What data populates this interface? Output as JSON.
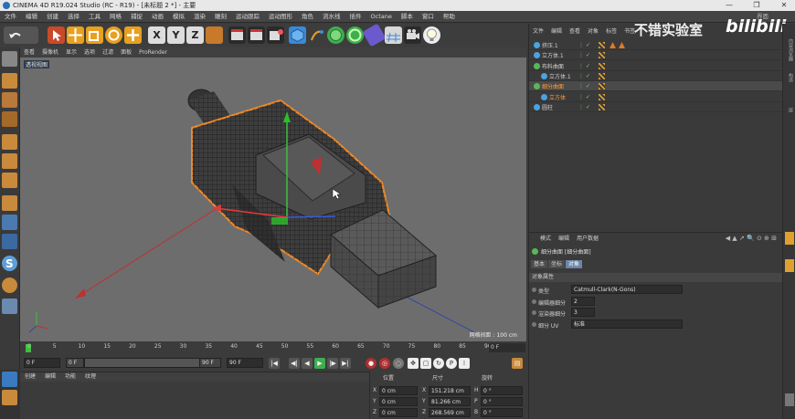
{
  "window": {
    "title": "CINEMA 4D R19.024 Studio (RC - R19) - [未标题 2 *] - 主要",
    "controls": [
      "—",
      "❐",
      "✕"
    ]
  },
  "menubar": {
    "items": [
      "文件",
      "编辑",
      "创建",
      "选择",
      "工具",
      "网格",
      "捕捉",
      "动画",
      "模拟",
      "渲染",
      "雕刻",
      "运动跟踪",
      "运动图形",
      "角色",
      "流水线",
      "插件",
      "Octane",
      "脚本",
      "窗口",
      "帮助"
    ],
    "right_label": "界面"
  },
  "viewport": {
    "menu": [
      "查看",
      "摄像机",
      "显示",
      "选项",
      "过滤",
      "面板",
      "ProRender"
    ],
    "label": "透视视图",
    "grid_label": "网格间距 : 100 cm"
  },
  "timeline": {
    "ticks": [
      "0",
      "5",
      "10",
      "15",
      "20",
      "25",
      "30",
      "35",
      "40",
      "45",
      "50",
      "55",
      "60",
      "65",
      "70",
      "75",
      "80",
      "85",
      "90"
    ],
    "end_frame": "0 F"
  },
  "transport": {
    "current": "0 F",
    "preview_start": "0 F",
    "preview_end": "90 F",
    "end": "90 F"
  },
  "material_manager": {
    "menu": [
      "创建",
      "编辑",
      "功能",
      "纹理"
    ]
  },
  "coords": {
    "headers": {
      "position": "位置",
      "size": "尺寸",
      "rotation": "旋转"
    },
    "rows": [
      {
        "axis": "X",
        "pos": "0 cm",
        "size_axis": "X",
        "size": "151.218 cm",
        "rot_axis": "H",
        "rot": "0 °"
      },
      {
        "axis": "Y",
        "pos": "0 cm",
        "size_axis": "Y",
        "size": "81.266 cm",
        "rot_axis": "P",
        "rot": "0 °"
      },
      {
        "axis": "Z",
        "pos": "0 cm",
        "size_axis": "Z",
        "size": "268.569 cm",
        "rot_axis": "B",
        "rot": "0 °"
      }
    ]
  },
  "object_manager": {
    "menu": [
      "文件",
      "编辑",
      "查看",
      "对象",
      "标签",
      "书签"
    ],
    "objects": [
      {
        "name": "挤压.1",
        "indent": 0,
        "icon_color": "#4aa3e0",
        "highlight": false,
        "selected": false
      },
      {
        "name": "立方体.1",
        "indent": 0,
        "icon_color": "#4aa3e0",
        "highlight": false,
        "selected": false
      },
      {
        "name": "布料曲面",
        "indent": 0,
        "icon_color": "#58b858",
        "highlight": false,
        "selected": false
      },
      {
        "name": "立方体.1",
        "indent": 1,
        "icon_color": "#4aa3e0",
        "highlight": false,
        "selected": false
      },
      {
        "name": "细分曲面",
        "indent": 0,
        "icon_color": "#58b858",
        "highlight": true,
        "selected": true
      },
      {
        "name": "立方体",
        "indent": 1,
        "icon_color": "#4aa3e0",
        "highlight": true,
        "selected": false
      },
      {
        "name": "圆柱",
        "indent": 0,
        "icon_color": "#4aa3e0",
        "highlight": false,
        "selected": false
      }
    ]
  },
  "watermark": {
    "text": "不错实验室",
    "brand": "bilibili"
  },
  "attribute_manager": {
    "menu": [
      "模式",
      "编辑",
      "用户数据"
    ],
    "title": "细分曲面 [细分曲面]",
    "tabs": [
      {
        "label": "基本",
        "active": false
      },
      {
        "label": "坐标",
        "active": false
      },
      {
        "label": "对象",
        "active": true
      }
    ],
    "section": "对象属性",
    "fields": [
      {
        "label": "类型",
        "value": "Catmull-Clark(N-Gons)"
      },
      {
        "label": "编辑器细分",
        "value": "2"
      },
      {
        "label": "渲染器细分",
        "value": "3"
      },
      {
        "label": "细分 UV",
        "value": "标准"
      }
    ]
  },
  "right_strip": [
    "内容浏览器",
    "构造",
    "层"
  ],
  "colors": {
    "accent_orange": "#ff9b3a",
    "selection_blue": "#6b86a8",
    "panel_bg": "#3a3a3a",
    "viewport_bg": "#6e6e6e"
  }
}
